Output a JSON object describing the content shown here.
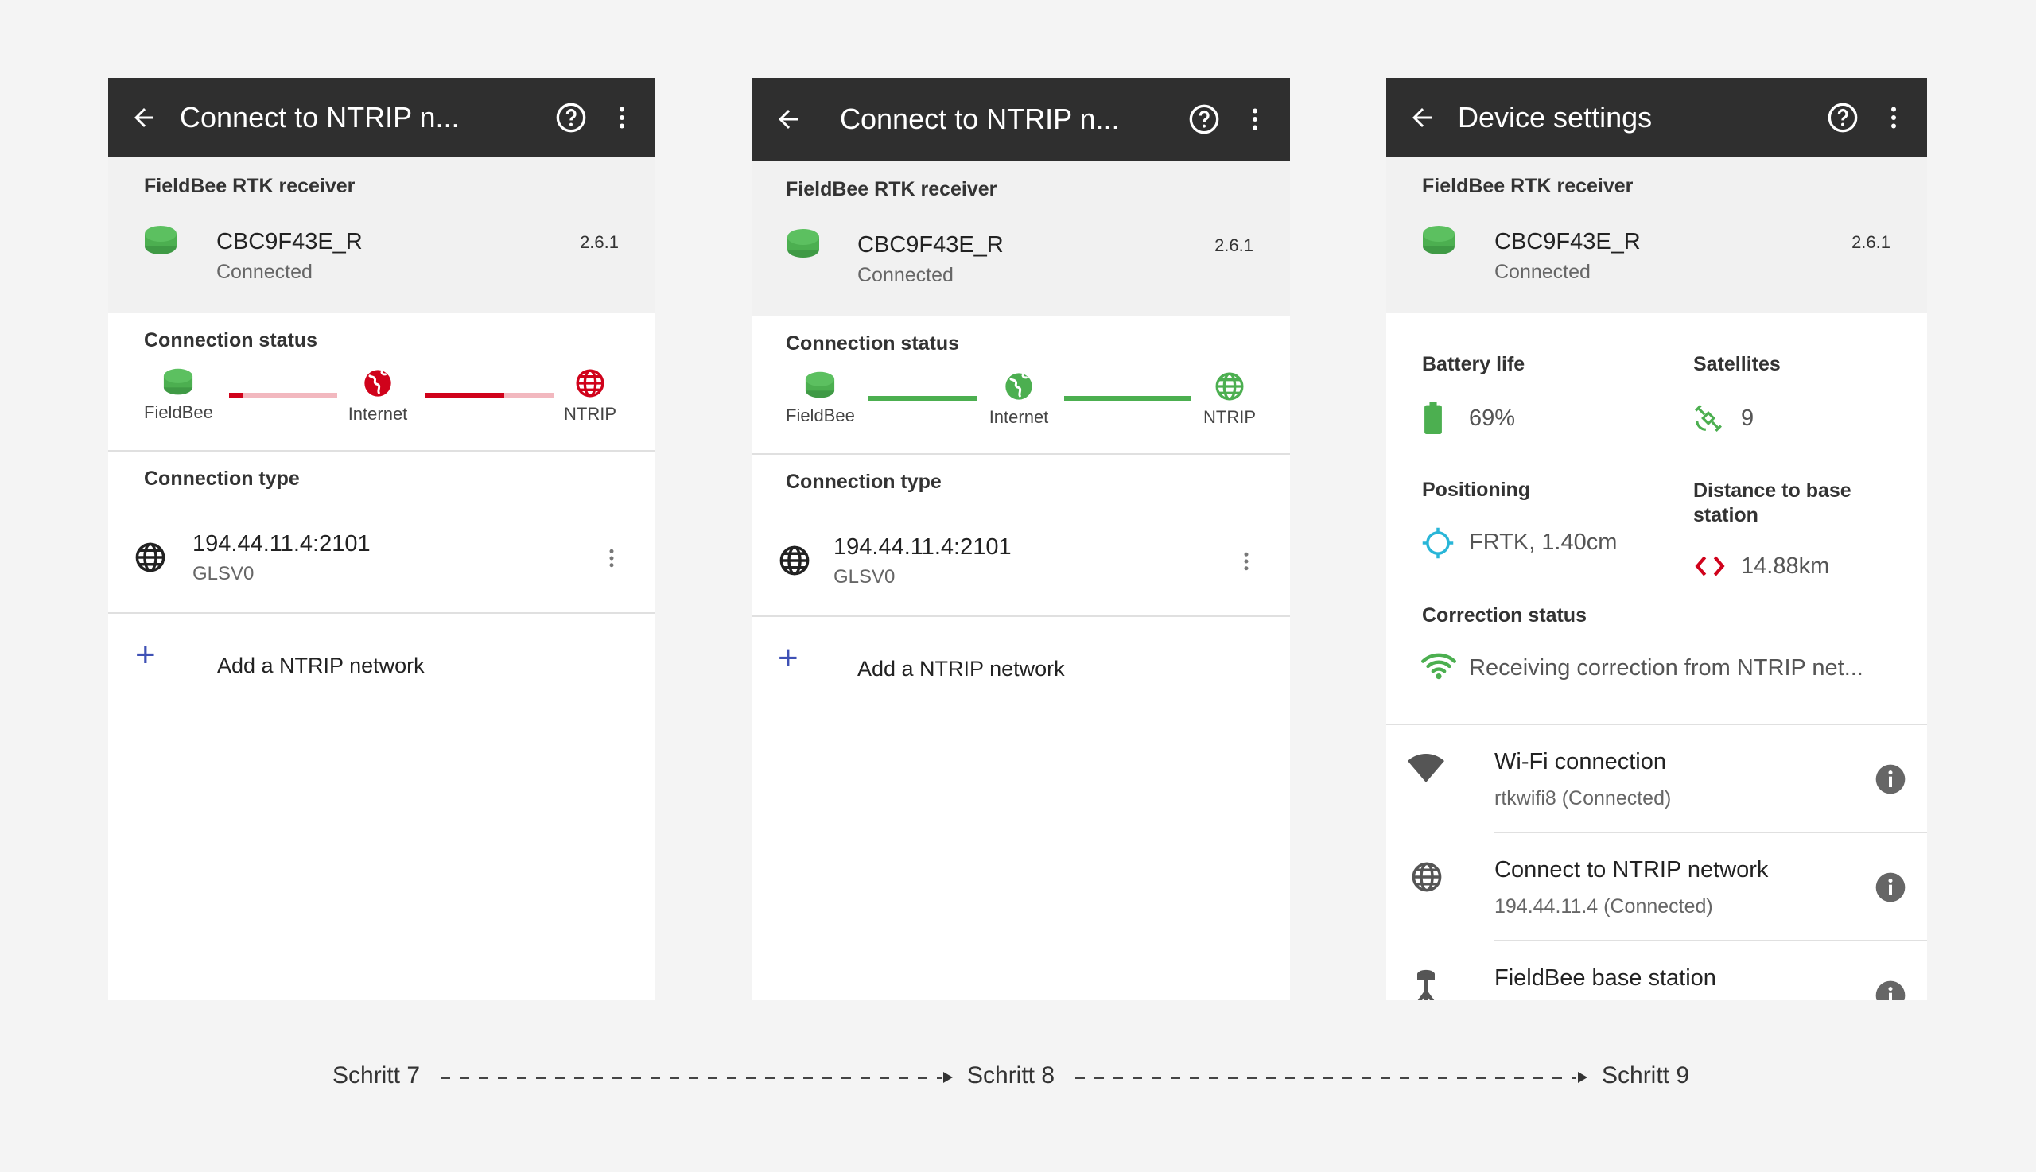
{
  "screens": [
    {
      "title": "Connect to NTRIP n...",
      "receiver": {
        "label": "FieldBee RTK receiver",
        "name": "CBC9F43E_R",
        "state": "Connected",
        "version": "2.6.1"
      },
      "status": {
        "title": "Connection status",
        "nodes": [
          "FieldBee",
          "Internet",
          "NTRIP"
        ]
      },
      "connection_type": {
        "title": "Connection type",
        "address": "194.44.11.4:2101",
        "mount": "GLSV0"
      },
      "add_label": "Add a NTRIP network"
    },
    {
      "title": "Connect to NTRIP n...",
      "receiver": {
        "label": "FieldBee RTK receiver",
        "name": "CBC9F43E_R",
        "state": "Connected",
        "version": "2.6.1"
      },
      "status": {
        "title": "Connection status",
        "nodes": [
          "FieldBee",
          "Internet",
          "NTRIP"
        ]
      },
      "connection_type": {
        "title": "Connection type",
        "address": "194.44.11.4:2101",
        "mount": "GLSV0"
      },
      "add_label": "Add a NTRIP network"
    },
    {
      "title": "Device settings",
      "receiver": {
        "label": "FieldBee RTK receiver",
        "name": "CBC9F43E_R",
        "state": "Connected",
        "version": "2.6.1"
      },
      "info": {
        "battery_label": "Battery life",
        "battery_value": "69%",
        "satellites_label": "Satellites",
        "satellites_value": "9",
        "positioning_label": "Positioning",
        "positioning_value": "FRTK, 1.40cm",
        "distance_label": "Distance to base station",
        "distance_value": "14.88km",
        "correction_label": "Correction status",
        "correction_value": "Receiving correction from NTRIP net..."
      },
      "list": [
        {
          "title": "Wi-Fi connection",
          "subtitle": "rtkwifi8  (Connected)"
        },
        {
          "title": "Connect to NTRIP network",
          "subtitle": "194.44.11.4  (Connected)"
        },
        {
          "title": "FieldBee base station",
          "subtitle": ""
        }
      ]
    }
  ],
  "steps": [
    "Schritt 7",
    "Schritt 8",
    "Schritt 9"
  ],
  "colors": {
    "green": "#4caf50",
    "red": "#d0021b",
    "red_light": "#f2b8bf",
    "appbar": "#2f2f2f",
    "accent": "#3f51b5",
    "cyan": "#29b6d8"
  }
}
